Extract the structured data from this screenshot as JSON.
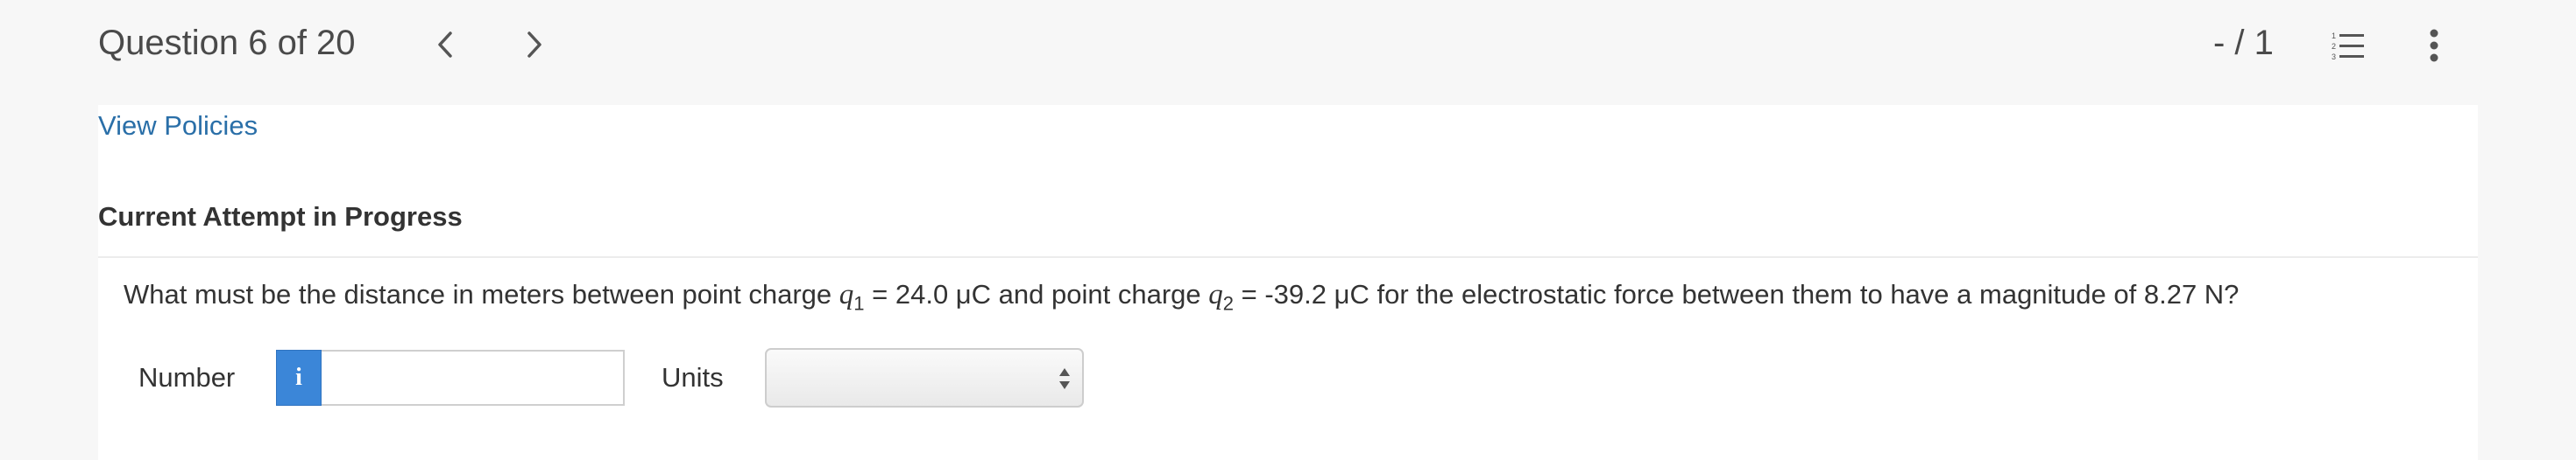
{
  "header": {
    "question_label": "Question 6 of 20",
    "prev_icon": "chevron-left-icon",
    "next_icon": "chevron-right-icon",
    "score": "- / 1",
    "list_icon": "numbered-list-icon",
    "more_icon": "vertical-ellipsis-icon"
  },
  "links": {
    "view_policies": "View Policies"
  },
  "attempt": {
    "heading": "Current Attempt in Progress"
  },
  "question": {
    "part1": "What must be the distance in meters between point charge ",
    "q1_var": "q",
    "q1_sub": "1",
    "part2": " = 24.0 μC and point charge ",
    "q2_var": "q",
    "q2_sub": "2",
    "part3": " = -39.2 μC for the electrostatic force between them to have a magnitude of 8.27 N?"
  },
  "answer": {
    "number_label": "Number",
    "info_label": "i",
    "number_value": "",
    "units_label": "Units",
    "units_selected": ""
  },
  "colors": {
    "link": "#2a6fa8",
    "info_button": "#3b86d8",
    "background": "#f7f7f7"
  }
}
